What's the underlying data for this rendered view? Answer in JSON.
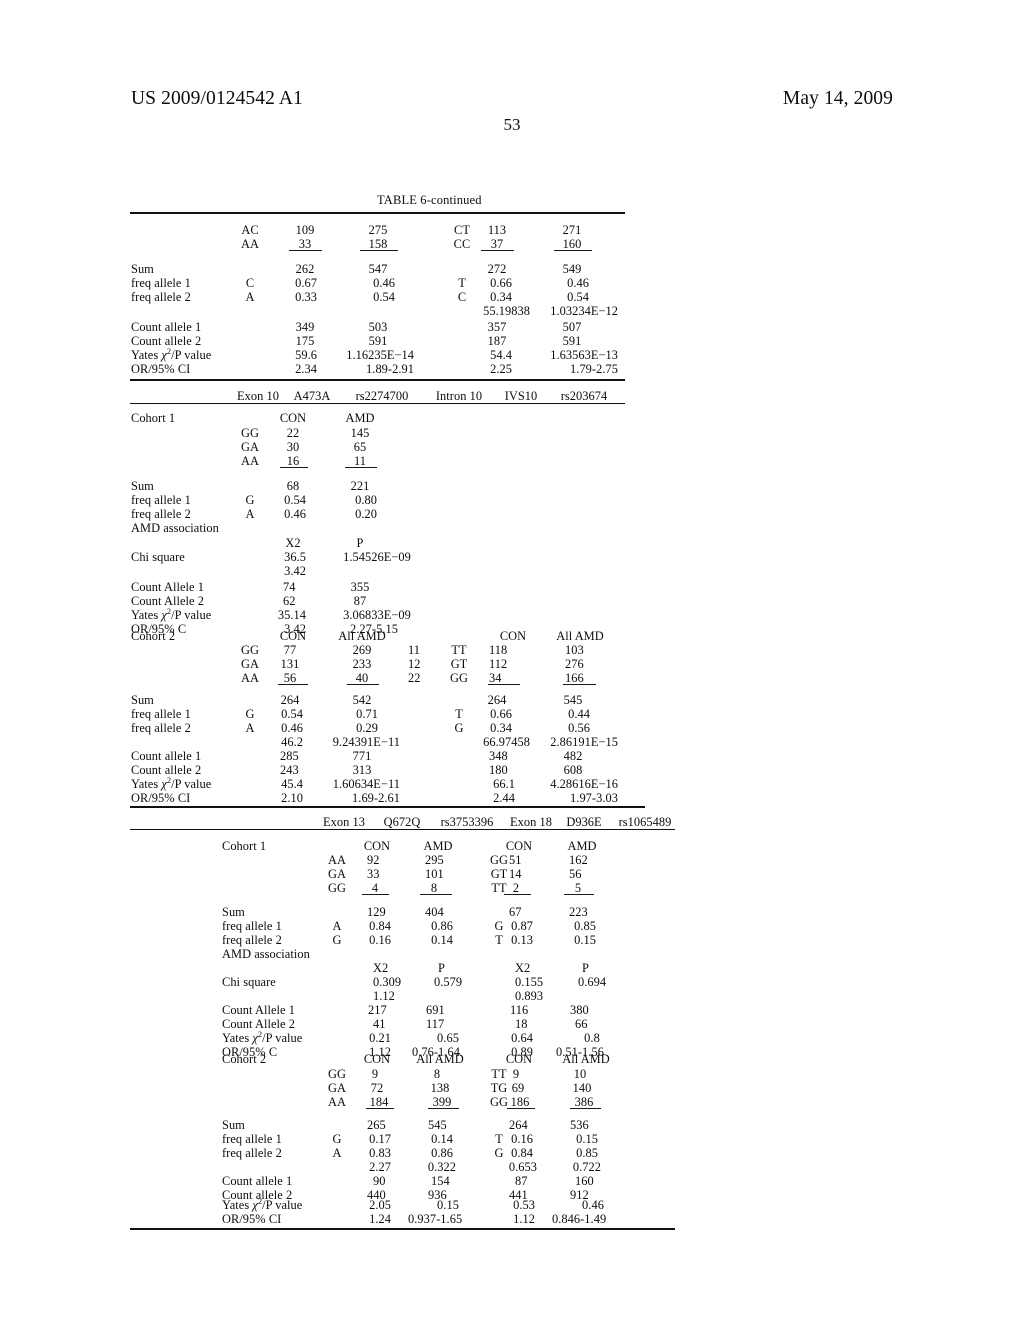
{
  "header": {
    "publication_number": "US 2009/0124542 A1",
    "publication_date": "May 14, 2009",
    "page_number": "53"
  },
  "table": {
    "caption": "TABLE 6-continued"
  },
  "labels": {
    "sum": "Sum",
    "freq_allele_1": "freq allele 1",
    "freq_allele_2": "freq allele 2",
    "count_allele_1_cap": "Count Allele 1",
    "count_allele_2_cap": "Count Allele 2",
    "count_allele_1": "Count allele 1",
    "count_allele_2": "Count allele 2",
    "yates": "Yates χ²/P value",
    "or_ci": "OR/95% CI",
    "or_c": "OR/95% C",
    "cohort1": "Cohort 1",
    "cohort2": "Cohort 2",
    "amd_association": "AMD association",
    "chi_square": "Chi square",
    "con": "CON",
    "amd": "AMD",
    "all_amd": "All AMD",
    "x2": "X2",
    "p": "P"
  },
  "block1": {
    "geno_rows": [
      {
        "left_code": "AC",
        "v1": "109",
        "v2": "275",
        "right_code": "CT",
        "v3": "113",
        "v4": "271"
      },
      {
        "left_code": "AA",
        "v1": "33",
        "v2": "158",
        "right_code": "CC",
        "v3": "37",
        "v4": "160"
      }
    ],
    "sum": {
      "v1": "262",
      "v2": "547",
      "v3": "272",
      "v4": "549"
    },
    "freq1": {
      "allele_left": "C",
      "v1": "0.67",
      "v2": "0.46",
      "allele_right": "T",
      "v3": "0.66",
      "v4": "0.46"
    },
    "freq2": {
      "allele_left": "A",
      "v1": "0.33",
      "v2": "0.54",
      "allele_right": "C",
      "v3": "0.34",
      "v4": "0.54"
    },
    "chi_row": {
      "v3": "55.19838",
      "v4": "1.03234E−12"
    },
    "count1": {
      "v1": "349",
      "v2": "503",
      "v3": "357",
      "v4": "507"
    },
    "count2": {
      "v1": "175",
      "v2": "591",
      "v3": "187",
      "v4": "591"
    },
    "yates": {
      "v1": "59.6",
      "v2": "1.16235E−14",
      "v3": "54.4",
      "v4": "1.63563E−13"
    },
    "or": {
      "v1": "2.34",
      "v2": "1.89-2.91",
      "v3": "2.25",
      "v4": "1.79-2.75"
    }
  },
  "block2": {
    "snp_header": [
      "Exon 10",
      "A473A",
      "rs2274700",
      "Intron 10",
      "IVS10",
      "rs203674"
    ],
    "cohort1": {
      "col_headers": [
        "CON",
        "AMD"
      ],
      "geno_rows": [
        {
          "code": "GG",
          "con": "22",
          "amd": "145"
        },
        {
          "code": "GA",
          "con": "30",
          "amd": "65"
        },
        {
          "code": "AA",
          "con": "16",
          "amd": "11"
        }
      ],
      "sum": {
        "con": "68",
        "amd": "221"
      },
      "freq1": {
        "allele": "G",
        "con": "0.54",
        "amd": "0.80"
      },
      "freq2": {
        "allele": "A",
        "con": "0.46",
        "amd": "0.20"
      },
      "chi_square": {
        "x2": "36.5",
        "p": "1.54526E−09"
      },
      "chi_extra": "3.42",
      "count1": {
        "con": "74",
        "amd": "355"
      },
      "count2": {
        "con": "62",
        "amd": "87"
      },
      "yates": {
        "v1": "35.14",
        "v2": "3.06833E−09"
      },
      "or": {
        "v1": "3.42",
        "v2": "2.27-5.15"
      }
    },
    "cohort2": {
      "col_headers_left": [
        "CON",
        "All AMD"
      ],
      "col_headers_right": [
        "CON",
        "All AMD"
      ],
      "geno_rows": [
        {
          "code": "GG",
          "con": "77",
          "amd": "269",
          "num": "11",
          "rcode": "TT",
          "rcon": "118",
          "ramd": "103"
        },
        {
          "code": "GA",
          "con": "131",
          "amd": "233",
          "num": "12",
          "rcode": "GT",
          "rcon": "112",
          "ramd": "276"
        },
        {
          "code": "AA",
          "con": "56",
          "amd": "40",
          "num": "22",
          "rcode": "GG",
          "rcon": "34",
          "ramd": "166"
        }
      ],
      "sum": {
        "v1": "264",
        "v2": "542",
        "v3": "264",
        "v4": "545"
      },
      "freq1": {
        "allele_left": "G",
        "v1": "0.54",
        "v2": "0.71",
        "allele_right": "T",
        "v3": "0.66",
        "v4": "0.44"
      },
      "freq2": {
        "allele_left": "A",
        "v1": "0.46",
        "v2": "0.29",
        "allele_right": "G",
        "v3": "0.34",
        "v4": "0.56"
      },
      "chi_row": {
        "v1": "46.2",
        "v2": "9.24391E−11",
        "v3": "66.97458",
        "v4": "2.86191E−15"
      },
      "count1": {
        "v1": "285",
        "v2": "771",
        "v3": "348",
        "v4": "482"
      },
      "count2": {
        "v1": "243",
        "v2": "313",
        "v3": "180",
        "v4": "608"
      },
      "yates": {
        "v1": "45.4",
        "v2": "1.60634E−11",
        "v3": "66.1",
        "v4": "4.28616E−16"
      },
      "or": {
        "v1": "2.10",
        "v2": "1.69-2.61",
        "v3": "2.44",
        "v4": "1.97-3.03"
      }
    }
  },
  "block3": {
    "snp_header": [
      "Exon 13",
      "Q672Q",
      "rs3753396",
      "Exon 18",
      "D936E",
      "rs1065489"
    ],
    "cohort1": {
      "col_headers_left": [
        "CON",
        "AMD"
      ],
      "col_headers_right": [
        "CON",
        "AMD"
      ],
      "geno_rows": [
        {
          "code": "AA",
          "con": "92",
          "amd": "295",
          "rcode": "GG",
          "rcon": "51",
          "ramd": "162"
        },
        {
          "code": "GA",
          "con": "33",
          "amd": "101",
          "rcode": "GT",
          "rcon": "14",
          "ramd": "56"
        },
        {
          "code": "GG",
          "con": "4",
          "amd": "8",
          "rcode": "TT",
          "rcon": "2",
          "ramd": "5"
        }
      ],
      "sum": {
        "v1": "129",
        "v2": "404",
        "v3": "67",
        "v4": "223"
      },
      "freq1": {
        "allele_left": "A",
        "v1": "0.84",
        "v2": "0.86",
        "allele_right": "G",
        "v3": "0.87",
        "v4": "0.85"
      },
      "freq2": {
        "allele_left": "G",
        "v1": "0.16",
        "v2": "0.14",
        "allele_right": "T",
        "v3": "0.13",
        "v4": "0.15"
      },
      "chi_square": {
        "v1": "0.309",
        "v2": "0.579",
        "v3": "0.155",
        "v4": "0.694"
      },
      "chi_extra_left": "1.12",
      "chi_extra_right": "0.893",
      "count1": {
        "v1": "217",
        "v2": "691",
        "v3": "116",
        "v4": "380"
      },
      "count2": {
        "v1": "41",
        "v2": "117",
        "v3": "18",
        "v4": "66"
      },
      "yates": {
        "v1": "0.21",
        "v2": "0.65",
        "v3": "0.64",
        "v4": "0.8"
      },
      "or": {
        "v1": "1.12",
        "v2": "0.76-1.64",
        "v3": "0.89",
        "v4": "0.51-1.56"
      }
    },
    "cohort2": {
      "col_headers_left": [
        "CON",
        "All AMD"
      ],
      "col_headers_right": [
        "CON",
        "All AMD"
      ],
      "geno_rows": [
        {
          "code": "GG",
          "con": "9",
          "amd": "8",
          "rcode": "TT",
          "rcon": "9",
          "ramd": "10"
        },
        {
          "code": "GA",
          "con": "72",
          "amd": "138",
          "rcode": "TG",
          "rcon": "69",
          "ramd": "140"
        },
        {
          "code": "AA",
          "con": "184",
          "amd": "399",
          "rcode": "GG",
          "rcon": "186",
          "ramd": "386"
        }
      ],
      "sum": {
        "v1": "265",
        "v2": "545",
        "v3": "264",
        "v4": "536"
      },
      "freq1": {
        "allele_left": "G",
        "v1": "0.17",
        "v2": "0.14",
        "allele_right": "T",
        "v3": "0.16",
        "v4": "0.15"
      },
      "freq2": {
        "allele_left": "A",
        "v1": "0.83",
        "v2": "0.86",
        "allele_right": "G",
        "v3": "0.84",
        "v4": "0.85"
      },
      "chi_row": {
        "v1": "2.27",
        "v2": "0.322",
        "v3": "0.653",
        "v4": "0.722"
      },
      "count1": {
        "v1": "90",
        "v2": "154",
        "v3": "87",
        "v4": "160"
      },
      "count2": {
        "v1": "440",
        "v2": "936",
        "v3": "441",
        "v4": "912"
      },
      "yates": {
        "v1": "2.05",
        "v2": "0.15",
        "v3": "0.53",
        "v4": "0.46"
      },
      "or": {
        "v1": "1.24",
        "v2": "0.937-1.65",
        "v3": "1.12",
        "v4": "0.846-1.49"
      }
    }
  }
}
